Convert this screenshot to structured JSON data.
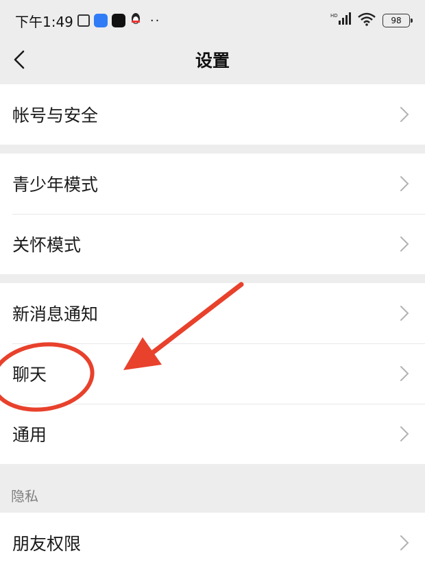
{
  "status_bar": {
    "time": "下午1:49",
    "battery": "98",
    "more": "··"
  },
  "nav": {
    "title": "设置"
  },
  "groups": [
    {
      "items": [
        {
          "label": "帐号与安全"
        }
      ]
    },
    {
      "items": [
        {
          "label": "青少年模式"
        },
        {
          "label": "关怀模式"
        }
      ]
    },
    {
      "items": [
        {
          "label": "新消息通知"
        },
        {
          "label": "聊天"
        },
        {
          "label": "通用"
        }
      ]
    },
    {
      "header": "隐私",
      "items": [
        {
          "label": "朋友权限"
        }
      ]
    }
  ],
  "colors": {
    "annotation": "#e8412c",
    "background": "#ededed",
    "cell": "#ffffff"
  },
  "icons": [
    "back-icon",
    "chevron-right-icon",
    "signal-icon",
    "wifi-icon",
    "battery-icon"
  ]
}
